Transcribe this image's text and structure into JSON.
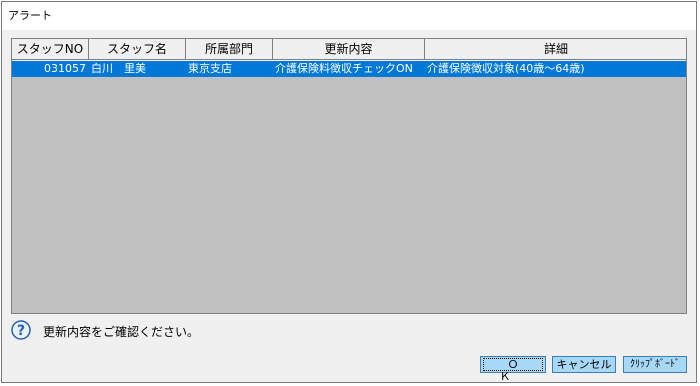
{
  "window": {
    "title": "アラート"
  },
  "grid": {
    "columns": [
      "スタッフNO",
      "スタッフ名",
      "所属部門",
      "更新内容",
      "詳細"
    ],
    "rows": [
      {
        "staff_no": "031057",
        "staff_name": "白川　里美",
        "department": "東京支店",
        "update": "介護保険料徴収チェックON",
        "detail": "介護保険徴収対象(40歳～64歳)"
      }
    ]
  },
  "status": {
    "message": "更新内容をご確認ください。",
    "icon": "question-icon"
  },
  "buttons": {
    "ok": "ＯＫ",
    "cancel": "キャンセル",
    "clipboard": "ｸﾘｯﾌﾟﾎﾞｰﾄﾞ"
  },
  "colors": {
    "selection": "#0078d7",
    "grid_bg": "#c0c0c0",
    "button_bg": "#a8d8f8"
  }
}
